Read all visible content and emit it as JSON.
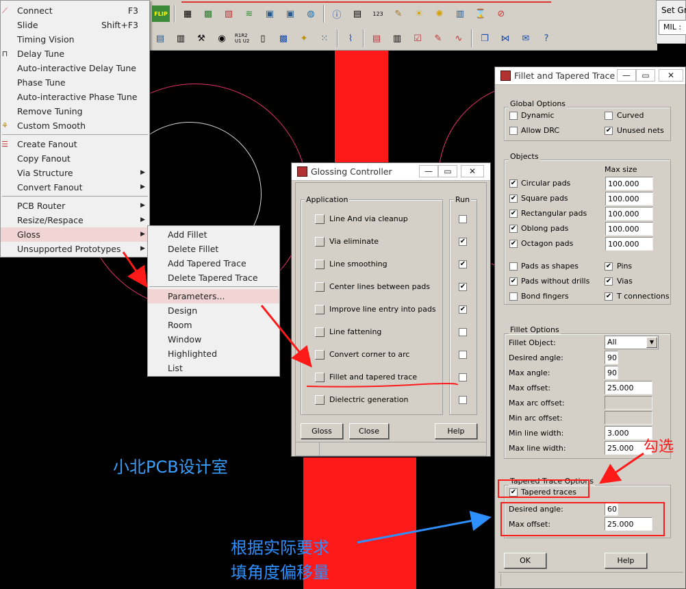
{
  "main_menu": {
    "items": [
      {
        "label": "Connect",
        "shortcut": "F3",
        "icon": "connect-icon"
      },
      {
        "label": "Slide",
        "shortcut": "Shift+F3"
      },
      {
        "label": "Timing Vision"
      },
      {
        "label": "Delay Tune",
        "icon": "delay-tune-icon"
      },
      {
        "label": "Auto-interactive Delay Tune"
      },
      {
        "label": "Phase Tune"
      },
      {
        "label": "Auto-interactive Phase Tune"
      },
      {
        "label": "Remove Tuning"
      },
      {
        "label": "Custom Smooth",
        "icon": "custom-smooth-icon"
      },
      {
        "label": "Create Fanout",
        "icon": "fanout-icon"
      },
      {
        "label": "Copy Fanout"
      },
      {
        "label": "Via Structure"
      },
      {
        "label": "Convert Fanout"
      },
      {
        "label": "PCB Router"
      },
      {
        "label": "Resize/Respace"
      },
      {
        "label": "Gloss"
      },
      {
        "label": "Unsupported Prototypes"
      }
    ]
  },
  "gloss_submenu": {
    "items": [
      {
        "label": "Add Fillet"
      },
      {
        "label": "Delete Fillet"
      },
      {
        "label": "Add Tapered Trace"
      },
      {
        "label": "Delete Tapered Trace"
      },
      {
        "label": "Parameters..."
      },
      {
        "label": "Design"
      },
      {
        "label": "Room"
      },
      {
        "label": "Window"
      },
      {
        "label": "Highlighted"
      },
      {
        "label": "List"
      }
    ]
  },
  "toolbar": {
    "flip": "FLIP",
    "num123": "123",
    "r1r2": "R1R2 U1 U2"
  },
  "set_grid": {
    "title": "Set Gr",
    "unit": "MIL :"
  },
  "glossing_controller": {
    "title": "Glossing Controller",
    "application_label": "Application",
    "run_label": "Run",
    "rows": [
      {
        "label": "Line And via cleanup",
        "run": false
      },
      {
        "label": "Via eliminate",
        "run": true
      },
      {
        "label": "Line smoothing",
        "run": true
      },
      {
        "label": "Center lines between pads",
        "run": true
      },
      {
        "label": "Improve line entry into pads",
        "run": true
      },
      {
        "label": "Line fattening",
        "run": false
      },
      {
        "label": "Convert corner to arc",
        "run": false
      },
      {
        "label": "Fillet and tapered trace",
        "run": false
      },
      {
        "label": "Dielectric generation",
        "run": false
      }
    ],
    "buttons": {
      "gloss": "Gloss",
      "close": "Close",
      "help": "Help"
    }
  },
  "fillet_dialog": {
    "title": "Fillet and Tapered Trace",
    "global_options": {
      "label": "Global Options",
      "dynamic": {
        "label": "Dynamic",
        "checked": false
      },
      "curved": {
        "label": "Curved",
        "checked": false
      },
      "allow_drc": {
        "label": "Allow DRC",
        "checked": false
      },
      "unused_nets": {
        "label": "Unused nets",
        "checked": true
      }
    },
    "objects": {
      "label": "Objects",
      "max_size_label": "Max size",
      "pads": [
        {
          "label": "Circular pads",
          "checked": true,
          "value": "100.000"
        },
        {
          "label": "Square pads",
          "checked": true,
          "value": "100.000"
        },
        {
          "label": "Rectangular pads",
          "checked": true,
          "value": "100.000"
        },
        {
          "label": "Oblong pads",
          "checked": true,
          "value": "100.000"
        },
        {
          "label": "Octagon pads",
          "checked": true,
          "value": "100.000"
        }
      ],
      "pads_as_shapes": {
        "label": "Pads as shapes",
        "checked": false
      },
      "pins": {
        "label": "Pins",
        "checked": true
      },
      "pads_without_drills": {
        "label": "Pads without drills",
        "checked": true
      },
      "vias": {
        "label": "Vias",
        "checked": true
      },
      "bond_fingers": {
        "label": "Bond fingers",
        "checked": false
      },
      "t_connections": {
        "label": "T connections",
        "checked": true
      }
    },
    "fillet_options": {
      "label": "Fillet Options",
      "fillet_object_label": "Fillet Object:",
      "fillet_object_value": "All",
      "desired_angle_label": "Desired angle:",
      "desired_angle": "90",
      "max_angle_label": "Max angle:",
      "max_angle": "90",
      "max_offset_label": "Max offset:",
      "max_offset": "25.000",
      "max_arc_offset_label": "Max arc offset:",
      "min_arc_offset_label": "Min arc offset:",
      "min_line_width_label": "Min line width:",
      "min_line_width": "3.000",
      "max_line_width_label": "Max line width:",
      "max_line_width": "25.000"
    },
    "tapered_options": {
      "label": "Tapered Trace Options",
      "tapered_traces": {
        "label": "Tapered traces",
        "checked": true
      },
      "desired_angle_label": "Desired angle:",
      "desired_angle": "60",
      "max_offset_label": "Max offset:",
      "max_offset": "25.000"
    },
    "buttons": {
      "ok": "OK",
      "help": "Help"
    }
  },
  "annotations": {
    "watermark": "小北PCB设计室",
    "check_note": "勾选",
    "fill_note_line1": "根据实际要求",
    "fill_note_line2": "填角度偏移量"
  },
  "colors": {
    "annotation_red": "#ff1a1a",
    "annotation_blue": "#2e8fff",
    "watermark_blue": "#3aa0ff",
    "trace_red": "#ff1a1a",
    "dialog_face": "#d4d0c8"
  }
}
